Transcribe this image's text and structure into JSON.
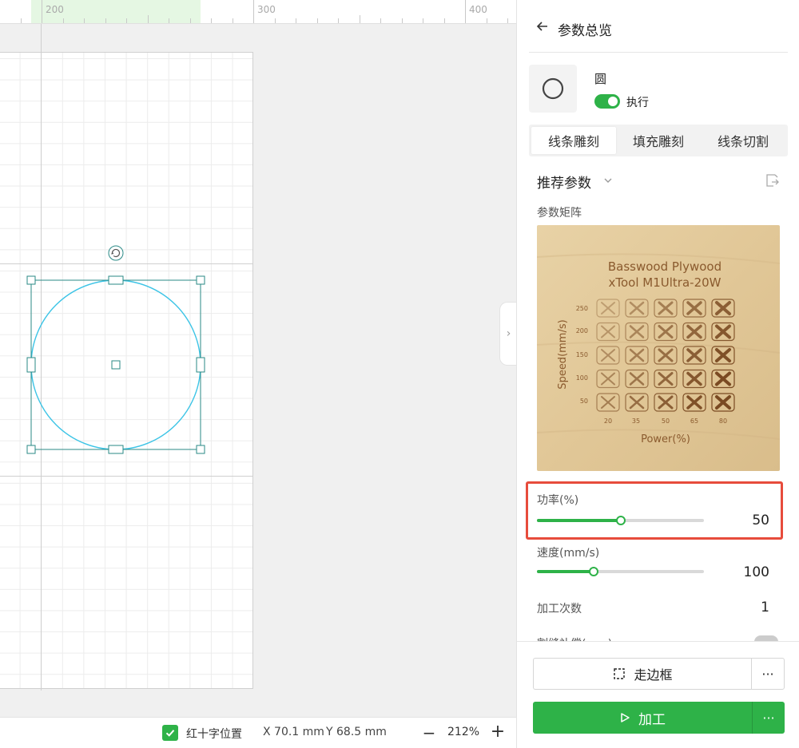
{
  "ruler": {
    "labels": [
      "200",
      "300",
      "400"
    ]
  },
  "statusbar": {
    "crosshair_label": "红十字位置",
    "x_readout": "X 70.1 mm",
    "y_readout": "Y 68.5 mm",
    "zoom_out": "−",
    "zoom_level": "212%",
    "zoom_in": "+"
  },
  "panel": {
    "title": "参数总览",
    "shape_name": "圆",
    "exec_label": "执行",
    "tabs": [
      {
        "label": "线条雕刻",
        "active": true
      },
      {
        "label": "填充雕刻",
        "active": false
      },
      {
        "label": "线条切割",
        "active": false
      }
    ],
    "preset_label": "推荐参数",
    "matrix_label": "参数矩阵",
    "matrix": {
      "title_line1": "Basswood Plywood",
      "title_line2": "xTool M1Ultra-20W",
      "y_axis": "Speed(mm/s)",
      "x_axis": "Power(%)",
      "speeds": [
        "250",
        "200",
        "150",
        "100",
        "50"
      ],
      "powers": [
        "20",
        "35",
        "50",
        "65",
        "80"
      ]
    },
    "power": {
      "label": "功率(%)",
      "value": "50",
      "fraction": 0.5
    },
    "speed": {
      "label": "速度(mm/s)",
      "value": "100",
      "fraction": 0.34
    },
    "passes": {
      "label": "加工次数",
      "value": "1"
    },
    "kerf": {
      "label": "割缝补偿(mm)"
    },
    "frame_button": "走边框",
    "frame_more": "···",
    "process_button": "加工",
    "process_more": "···"
  },
  "colors": {
    "accent": "#2eb248",
    "selection": "#2a8a86",
    "shape_stroke": "#3cc4e6",
    "highlight_box": "#e74c3c"
  }
}
